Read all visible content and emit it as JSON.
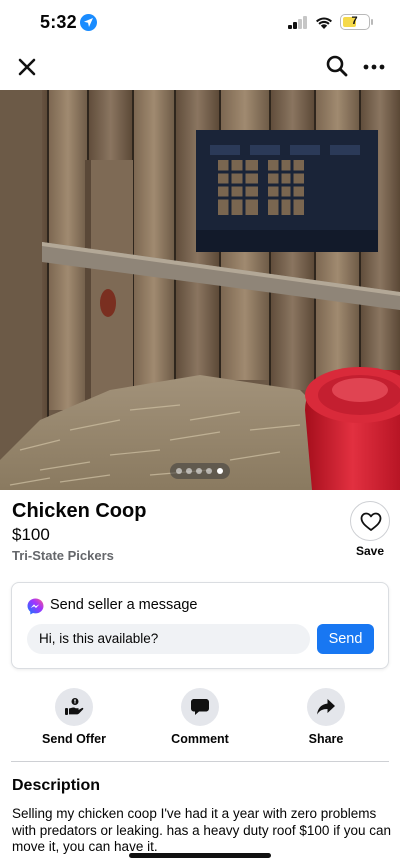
{
  "status_bar": {
    "time": "5:32",
    "battery_level": "7",
    "battery_color": "#f5d94a",
    "icons": [
      "location-arrow-icon",
      "signal-icon",
      "wifi-icon",
      "battery-icon"
    ]
  },
  "nav": {
    "icons": [
      "close-icon",
      "search-icon",
      "more-icon"
    ]
  },
  "photo": {
    "subject": "chicken coop interior",
    "carousel_count": 5,
    "carousel_active_index": 4
  },
  "listing": {
    "title": "Chicken Coop",
    "price": "$100",
    "seller": "Tri-State Pickers",
    "save_label": "Save"
  },
  "message": {
    "heading": "Send seller a message",
    "input_value": "Hi, is this available?",
    "send_label": "Send",
    "accent_color": "#1877f2"
  },
  "actions": [
    {
      "label": "Send Offer",
      "icon": "hand-offer-icon"
    },
    {
      "label": "Comment",
      "icon": "speech-bubble-icon"
    },
    {
      "label": "Share",
      "icon": "share-arrow-icon"
    }
  ],
  "description": {
    "heading": "Description",
    "text": "Selling my chicken coop I've had it a year with zero problems with predators or leaking. has a heavy duty roof $100 if you can move it, you can have it."
  }
}
